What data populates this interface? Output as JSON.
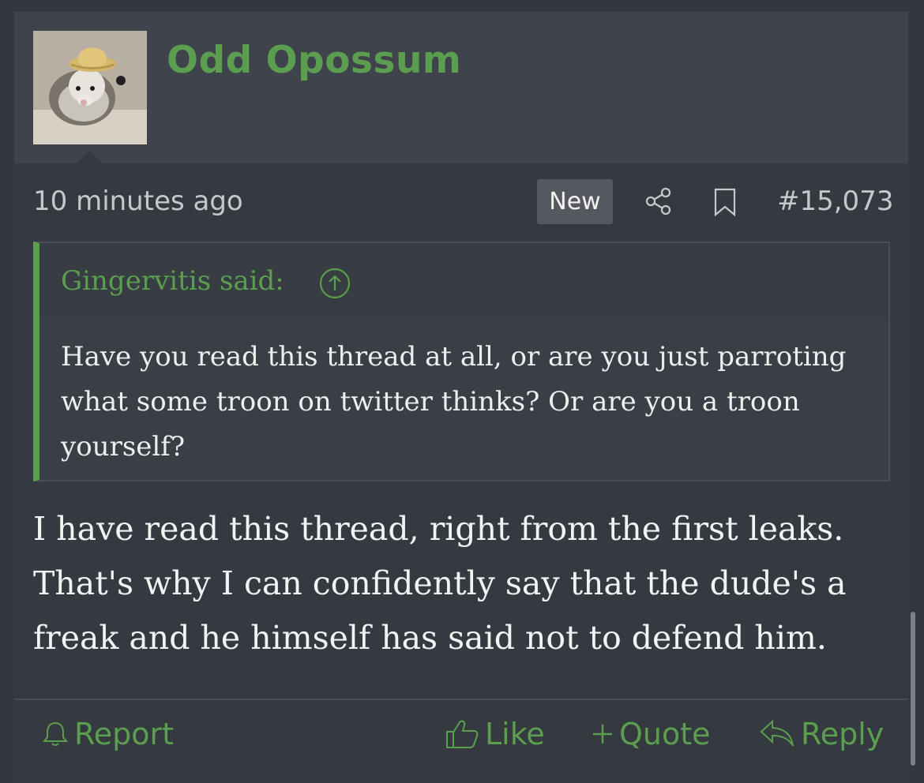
{
  "post": {
    "author": "Odd Opossum",
    "time": "10 minutes ago",
    "badge": "New",
    "post_number": "#15,073",
    "quote": {
      "author": "Gingervitis said:",
      "text": "Have you read this thread at all, or are you just parroting what some troon on twitter thinks? Or are you a troon yourself?"
    },
    "message": "I have read this thread, right from the first leaks. That's why I can confidently say that the dude's a freak and he himself has said not to defend him.",
    "actions": {
      "report": "Report",
      "like": "Like",
      "quote": "Quote",
      "reply": "Reply"
    }
  },
  "icons": [
    "avatar",
    "share-icon",
    "bookmark-icon",
    "arrow-up-circle-icon",
    "bell-icon",
    "thumbs-up-icon",
    "plus-icon",
    "reply-icon"
  ],
  "colors": {
    "accent": "#5c9e4f",
    "background": "#353940",
    "header_background": "#3f434b",
    "text": "#f2f3f5"
  }
}
